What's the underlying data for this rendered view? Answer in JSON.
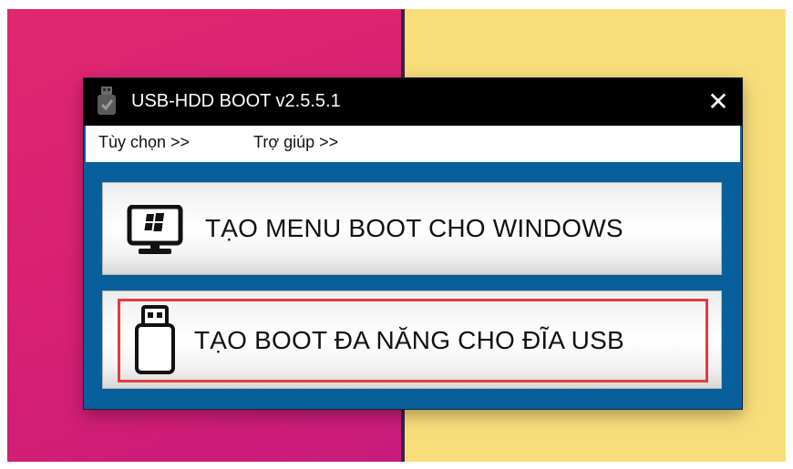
{
  "window": {
    "title": "USB-HDD BOOT v2.5.5.1",
    "close_symbol": "✕"
  },
  "menu": {
    "items": [
      {
        "label": "Tùy chọn >>"
      },
      {
        "label": "Trợ giúp >>"
      }
    ]
  },
  "buttons": {
    "windows_menu": {
      "label": "TẠO MENU BOOT CHO WINDOWS",
      "icon": "windows-monitor-icon"
    },
    "usb_boot": {
      "label": "TẠO BOOT ĐA NĂNG CHO ĐĨA USB",
      "icon": "usb-drive-icon",
      "highlight_color": "#e53b3b"
    }
  },
  "colors": {
    "window_body": "#07609c",
    "titlebar": "#000000",
    "desktop_left": "#d81f74",
    "desktop_right": "#f8de7a"
  }
}
